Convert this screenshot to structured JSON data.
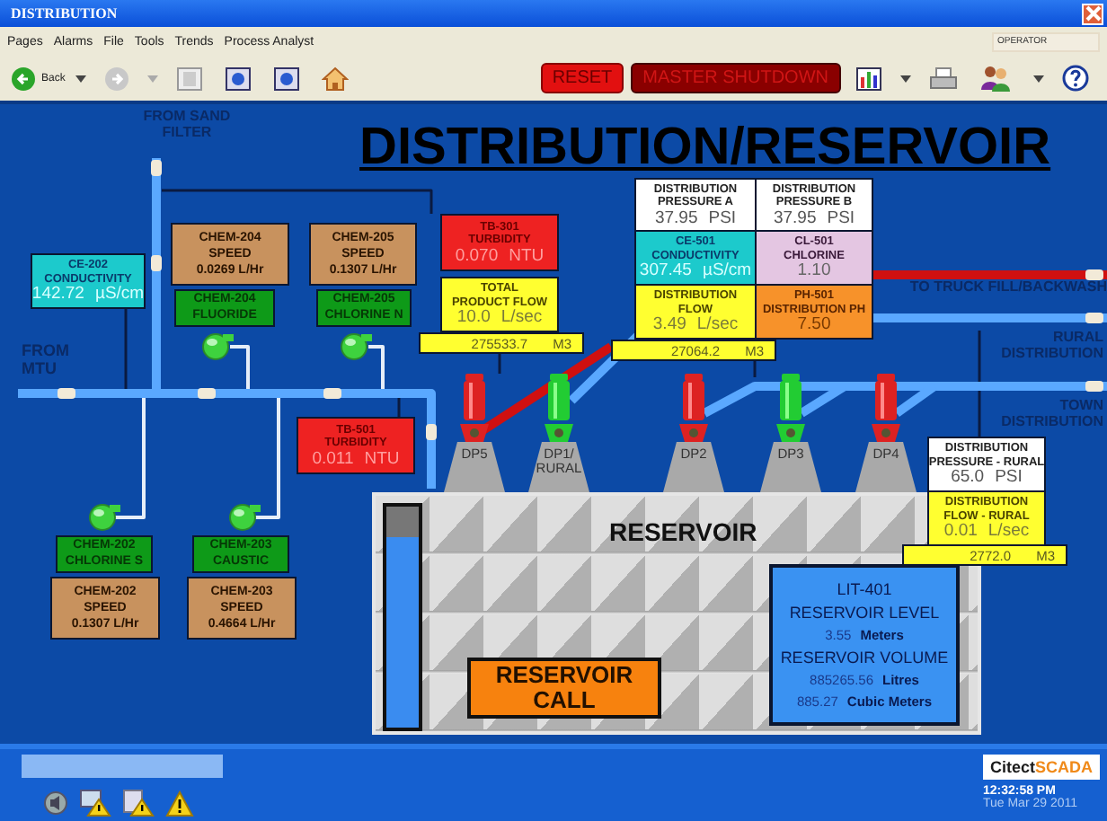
{
  "window": {
    "title": "DISTRIBUTION"
  },
  "menu": [
    "Pages",
    "Alarms",
    "File",
    "Tools",
    "Trends",
    "Process Analyst"
  ],
  "user_field": {
    "value": "OPERATOR"
  },
  "toolbar": {
    "back_label": "Back",
    "reset_label": "RESET",
    "shutdown_label": "MASTER SHUTDOWN"
  },
  "screen_title": "DISTRIBUTION/RESERVOIR",
  "flow_labels": [
    "FROM SAND FILTER",
    "FROM MTU",
    "TO TRUCK FILL/BACKWASH",
    "RURAL DISTRIBUTION",
    "TOWN DISTRIBUTION"
  ],
  "instruments": [
    {
      "kind": "conductivity",
      "lines": [
        "CE-202",
        "CONDUCTIVITY"
      ],
      "value": "142.72",
      "unit": "µS/cm"
    },
    {
      "kind": "speed",
      "lines": [
        "CHEM-204",
        "SPEED"
      ],
      "value": "0.0269 L/Hr"
    },
    {
      "kind": "chemical",
      "lines": [
        "CHEM-204",
        "FLUORIDE"
      ]
    },
    {
      "kind": "speed",
      "lines": [
        "CHEM-205",
        "SPEED"
      ],
      "value": "0.1307 L/Hr"
    },
    {
      "kind": "chemical",
      "lines": [
        "CHEM-205",
        "CHLORINE N"
      ]
    },
    {
      "kind": "turbidity",
      "lines": [
        "TB-301",
        "TURBIDITY"
      ],
      "value": "0.070",
      "unit": "NTU"
    },
    {
      "kind": "flow",
      "lines": [
        "TOTAL",
        "PRODUCT FLOW"
      ],
      "value": "10.0",
      "unit": "L/sec"
    },
    {
      "kind": "turbidity",
      "lines": [
        "TB-501",
        "TURBIDITY"
      ],
      "value": "0.011",
      "unit": "NTU"
    },
    {
      "kind": "pressure",
      "lines": [
        "DISTRIBUTION",
        "PRESSURE A"
      ],
      "value": "37.95",
      "unit": "PSI"
    },
    {
      "kind": "pressure",
      "lines": [
        "DISTRIBUTION",
        "PRESSURE B"
      ],
      "value": "37.95",
      "unit": "PSI"
    },
    {
      "kind": "conductivity",
      "lines": [
        "CE-501",
        "CONDUCTIVITY"
      ],
      "value": "307.45",
      "unit": "µS/cm"
    },
    {
      "kind": "chlorine",
      "lines": [
        "CL-501",
        "CHLORINE"
      ],
      "value": "1.10"
    },
    {
      "kind": "flow",
      "lines": [
        "DISTRIBUTION",
        "FLOW"
      ],
      "value": "3.49",
      "unit": "L/sec"
    },
    {
      "kind": "ph",
      "lines": [
        "PH-501",
        "DISTRIBUTION PH"
      ],
      "value": "7.50"
    },
    {
      "kind": "pressure",
      "lines": [
        "DISTRIBUTION",
        "PRESSURE - RURAL"
      ],
      "value": "65.0",
      "unit": "PSI"
    },
    {
      "kind": "flow",
      "lines": [
        "DISTRIBUTION",
        "FLOW - RURAL"
      ],
      "value": "0.01",
      "unit": "L/sec"
    },
    {
      "kind": "chemical",
      "lines": [
        "CHEM-202",
        "CHLORINE S"
      ]
    },
    {
      "kind": "speed",
      "lines": [
        "CHEM-202",
        "SPEED"
      ],
      "value": "0.1307 L/Hr"
    },
    {
      "kind": "chemical",
      "lines": [
        "CHEM-203",
        "CAUSTIC"
      ]
    },
    {
      "kind": "speed",
      "lines": [
        "CHEM-203",
        "SPEED"
      ],
      "value": "0.4664 L/Hr"
    }
  ],
  "totalizers": [
    {
      "value": "275533.7",
      "unit": "M3"
    },
    {
      "value": "27064.2",
      "unit": "M3"
    },
    {
      "value": "2772.0",
      "unit": "M3"
    }
  ],
  "dosing_pumps": [
    {
      "running": true
    },
    {
      "running": true
    },
    {
      "running": true
    },
    {
      "running": true
    }
  ],
  "delivery_pumps": [
    {
      "label": "DP5",
      "running": false
    },
    {
      "label": "DP1/ RURAL",
      "running": true
    },
    {
      "label": "DP2",
      "running": false
    },
    {
      "label": "DP3",
      "running": true
    },
    {
      "label": "DP4",
      "running": false
    }
  ],
  "reservoir": {
    "title": "RESERVOIR",
    "level": 0.86,
    "call_button": "RESERVOIR CALL",
    "info": {
      "tag": "LIT-401",
      "level_label": "RESERVOIR LEVEL",
      "level_value": "3.55",
      "level_unit": "Meters",
      "volume_label": "RESERVOIR VOLUME",
      "litres_value": "885265.56",
      "litres_unit": "Litres",
      "m3_value": "885.27",
      "m3_unit": "Cubic Meters"
    }
  },
  "status_bar": {
    "logo_name": "Citect",
    "logo_suffix": "SCADA",
    "time": "12:32:58 PM",
    "date": "Tue Mar 29 2011"
  }
}
